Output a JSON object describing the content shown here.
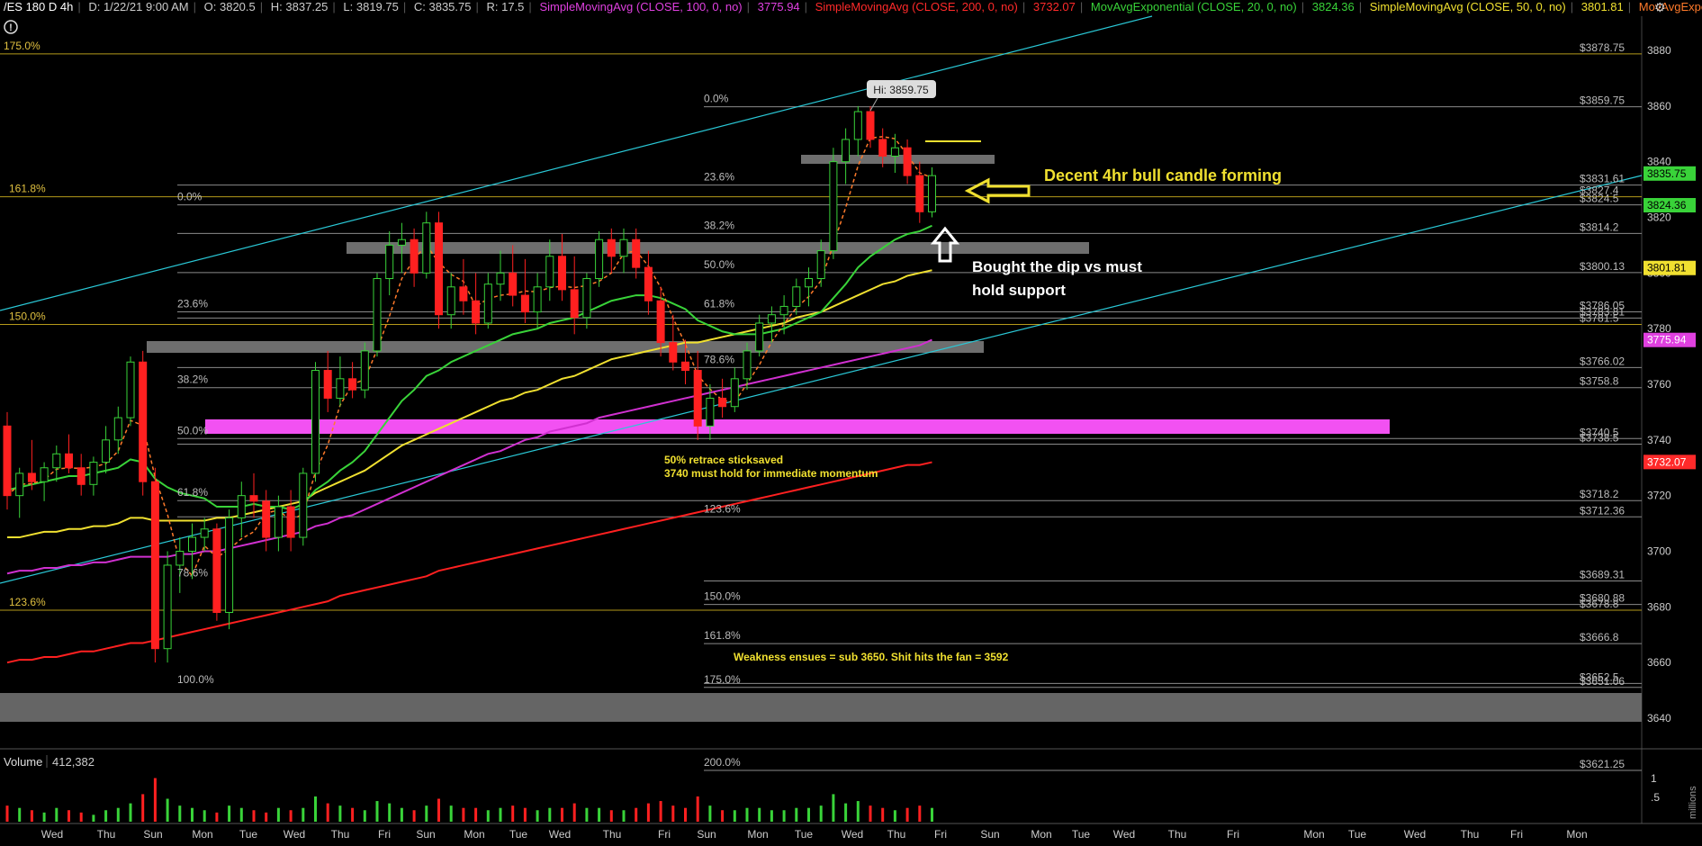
{
  "header": {
    "symbol": "/ES 180 D 4h",
    "date": "D: 1/22/21 9:00 AM",
    "open": "O: 3820.5",
    "high": "H: 3837.25",
    "low": "L: 3819.75",
    "close": "C: 3835.75",
    "range": "R: 17.5",
    "studies": [
      {
        "label": "SimpleMovingAvg (CLOSE, 100, 0, no)",
        "value": "3775.94",
        "color": "#e040e0"
      },
      {
        "label": "SimpleMovingAvg (CLOSE, 200, 0, no)",
        "value": "3732.07",
        "color": "#ff2a2a"
      },
      {
        "label": "MovAvgExponential (CLOSE, 20, 0, no)",
        "value": "3824.36",
        "color": "#39d339"
      },
      {
        "label": "SimpleMovingAvg (CLOSE, 50, 0, no)",
        "value": "3801.81",
        "color": "#f0e030"
      },
      {
        "label": "MovAvgExponential ...",
        "value": "",
        "color": "#ff7a2a"
      }
    ]
  },
  "info_icon": "info-icon",
  "chart_data": {
    "type": "candlestick",
    "symbol": "/ES",
    "timeframe": "4h",
    "ylim": [
      3630,
      3890
    ],
    "yticks": [
      3640,
      3660,
      3680,
      3700,
      3720,
      3740,
      3760,
      3780,
      3800,
      3820,
      3840,
      3860,
      3880
    ],
    "xticks": [
      "Wed",
      "Thu",
      "Sun",
      "Mon",
      "Tue",
      "Wed",
      "Thu",
      "Fri",
      "Sun",
      "Mon",
      "Tue",
      "Wed",
      "Thu",
      "Fri",
      "Sun",
      "Mon",
      "Tue",
      "Wed",
      "Thu",
      "Fri",
      "Sun",
      "Mon",
      "Tue",
      "Wed",
      "Thu",
      "Fri",
      "Mon",
      "Tue",
      "Wed",
      "Thu",
      "Fri",
      "Mon"
    ],
    "hi_label": "Hi: 3859.75",
    "price_levels": [
      "$3878.75",
      "$3859.75",
      "$3831.61",
      "$3827.4",
      "$3824.5",
      "$3814.2",
      "$3800.13",
      "$3786.05",
      "$3783.81",
      "$3781.5",
      "$3766.02",
      "$3758.8",
      "$3740.5",
      "$3738.5",
      "$3718.2",
      "$3712.36",
      "$3689.31",
      "$3680.88",
      "$3678.8",
      "$3666.8",
      "$3652.5",
      "$3651.06",
      "$3621.25"
    ],
    "fib_labels": [
      "175.0%",
      "0.0%",
      "23.6%",
      "161.8%",
      "0.0%",
      "38.2%",
      "50.0%",
      "150.0%",
      "23.6%",
      "61.8%",
      "78.6%",
      "38.2%",
      "50.0%",
      "61.8%",
      "123.6%",
      "78.6%",
      "123.6%",
      "100.0%",
      "150.0%",
      "161.8%",
      "175.0%",
      "200.0%"
    ],
    "axis_badges": [
      {
        "value": "3835.75",
        "price": 3835.75,
        "bg": "#39d339",
        "fg": "#000"
      },
      {
        "value": "3824.36",
        "price": 3824.36,
        "bg": "#39d339",
        "fg": "#000"
      },
      {
        "value": "3801.81",
        "price": 3801.81,
        "bg": "#f0e030",
        "fg": "#000"
      },
      {
        "value": "3775.94",
        "price": 3775.94,
        "bg": "#e040e0",
        "fg": "#fff"
      },
      {
        "value": "3732.07",
        "price": 3732.07,
        "bg": "#ff2a2a",
        "fg": "#fff"
      }
    ],
    "annotations": [
      "Decent 4hr bull candle forming",
      "Bought the dip vs must",
      "hold support",
      "50%  retrace sticksaved",
      "3740 must hold for immediate momentum",
      "Weakness ensues = sub 3650. Shit hits the fan = 3592"
    ],
    "candles": [
      [
        3745,
        3750,
        3715,
        3720
      ],
      [
        3720,
        3730,
        3712,
        3728
      ],
      [
        3728,
        3740,
        3722,
        3725
      ],
      [
        3725,
        3732,
        3718,
        3730
      ],
      [
        3730,
        3738,
        3725,
        3735
      ],
      [
        3735,
        3742,
        3728,
        3730
      ],
      [
        3730,
        3735,
        3720,
        3724
      ],
      [
        3724,
        3734,
        3720,
        3732
      ],
      [
        3732,
        3745,
        3728,
        3740
      ],
      [
        3740,
        3752,
        3735,
        3748
      ],
      [
        3748,
        3770,
        3745,
        3768
      ],
      [
        3768,
        3772,
        3720,
        3725
      ],
      [
        3725,
        3730,
        3660,
        3665
      ],
      [
        3665,
        3700,
        3660,
        3695
      ],
      [
        3695,
        3705,
        3685,
        3700
      ],
      [
        3700,
        3710,
        3690,
        3705
      ],
      [
        3705,
        3712,
        3700,
        3708
      ],
      [
        3708,
        3710,
        3675,
        3678
      ],
      [
        3678,
        3715,
        3672,
        3712
      ],
      [
        3712,
        3725,
        3705,
        3720
      ],
      [
        3720,
        3728,
        3712,
        3718
      ],
      [
        3718,
        3722,
        3700,
        3705
      ],
      [
        3705,
        3720,
        3700,
        3716
      ],
      [
        3716,
        3722,
        3700,
        3705
      ],
      [
        3705,
        3730,
        3702,
        3728
      ],
      [
        3728,
        3768,
        3725,
        3765
      ],
      [
        3765,
        3772,
        3750,
        3755
      ],
      [
        3755,
        3770,
        3752,
        3762
      ],
      [
        3762,
        3768,
        3755,
        3758
      ],
      [
        3758,
        3775,
        3755,
        3772
      ],
      [
        3772,
        3800,
        3770,
        3798
      ],
      [
        3798,
        3815,
        3792,
        3810
      ],
      [
        3810,
        3818,
        3800,
        3812
      ],
      [
        3812,
        3816,
        3795,
        3800
      ],
      [
        3800,
        3822,
        3798,
        3818
      ],
      [
        3818,
        3822,
        3780,
        3785
      ],
      [
        3785,
        3800,
        3780,
        3795
      ],
      [
        3795,
        3805,
        3785,
        3790
      ],
      [
        3790,
        3800,
        3778,
        3782
      ],
      [
        3782,
        3800,
        3780,
        3796
      ],
      [
        3796,
        3808,
        3790,
        3800
      ],
      [
        3800,
        3810,
        3788,
        3792
      ],
      [
        3792,
        3805,
        3782,
        3786
      ],
      [
        3786,
        3800,
        3780,
        3795
      ],
      [
        3795,
        3812,
        3790,
        3806
      ],
      [
        3806,
        3814,
        3790,
        3794
      ],
      [
        3794,
        3806,
        3778,
        3784
      ],
      [
        3784,
        3800,
        3780,
        3798
      ],
      [
        3798,
        3815,
        3795,
        3812
      ],
      [
        3812,
        3816,
        3800,
        3806
      ],
      [
        3806,
        3816,
        3800,
        3812
      ],
      [
        3812,
        3816,
        3798,
        3802
      ],
      [
        3802,
        3808,
        3785,
        3790
      ],
      [
        3790,
        3795,
        3770,
        3775
      ],
      [
        3775,
        3785,
        3765,
        3768
      ],
      [
        3768,
        3776,
        3760,
        3765
      ],
      [
        3765,
        3772,
        3740,
        3745
      ],
      [
        3745,
        3760,
        3740,
        3755
      ],
      [
        3755,
        3762,
        3748,
        3752
      ],
      [
        3752,
        3766,
        3750,
        3762
      ],
      [
        3762,
        3775,
        3758,
        3772
      ],
      [
        3772,
        3785,
        3770,
        3782
      ],
      [
        3782,
        3788,
        3775,
        3785
      ],
      [
        3785,
        3792,
        3778,
        3788
      ],
      [
        3788,
        3798,
        3785,
        3795
      ],
      [
        3795,
        3802,
        3788,
        3798
      ],
      [
        3798,
        3812,
        3795,
        3808
      ],
      [
        3808,
        3845,
        3805,
        3840
      ],
      [
        3840,
        3852,
        3832,
        3848
      ],
      [
        3848,
        3860,
        3842,
        3858
      ],
      [
        3858,
        3860,
        3845,
        3848
      ],
      [
        3848,
        3852,
        3838,
        3842
      ],
      [
        3842,
        3850,
        3836,
        3845
      ],
      [
        3845,
        3848,
        3832,
        3835
      ],
      [
        3835,
        3840,
        3818,
        3822
      ],
      [
        3822,
        3838,
        3820,
        3835
      ]
    ],
    "ema20": [
      3722,
      3723,
      3724,
      3725,
      3726,
      3727,
      3727,
      3728,
      3729,
      3730,
      3733,
      3732,
      3726,
      3723,
      3721,
      3720,
      3719,
      3716,
      3716,
      3716,
      3717,
      3716,
      3716,
      3715,
      3717,
      3722,
      3725,
      3729,
      3732,
      3736,
      3742,
      3748,
      3754,
      3758,
      3763,
      3765,
      3768,
      3770,
      3772,
      3774,
      3776,
      3778,
      3779,
      3780,
      3782,
      3783,
      3784,
      3786,
      3788,
      3790,
      3791,
      3792,
      3792,
      3791,
      3789,
      3787,
      3783,
      3781,
      3779,
      3778,
      3778,
      3778,
      3779,
      3780,
      3782,
      3784,
      3786,
      3791,
      3796,
      3802,
      3806,
      3809,
      3812,
      3814,
      3815,
      3817
    ],
    "sma50": [
      3705,
      3705,
      3706,
      3707,
      3707,
      3708,
      3708,
      3709,
      3709,
      3710,
      3712,
      3712,
      3711,
      3711,
      3711,
      3711,
      3711,
      3712,
      3712,
      3713,
      3714,
      3715,
      3716,
      3717,
      3718,
      3721,
      3723,
      3725,
      3727,
      3729,
      3732,
      3735,
      3738,
      3740,
      3742,
      3744,
      3746,
      3748,
      3750,
      3752,
      3754,
      3755,
      3757,
      3758,
      3760,
      3762,
      3763,
      3765,
      3767,
      3769,
      3770,
      3771,
      3772,
      3773,
      3774,
      3775,
      3775,
      3776,
      3777,
      3778,
      3779,
      3780,
      3781,
      3782,
      3784,
      3785,
      3786,
      3788,
      3790,
      3792,
      3794,
      3796,
      3797,
      3799,
      3800,
      3801
    ],
    "sma100": [
      3692,
      3693,
      3693,
      3694,
      3694,
      3695,
      3695,
      3696,
      3696,
      3697,
      3698,
      3698,
      3698,
      3698,
      3699,
      3699,
      3700,
      3700,
      3701,
      3702,
      3703,
      3704,
      3705,
      3706,
      3707,
      3709,
      3710,
      3712,
      3713,
      3715,
      3717,
      3719,
      3721,
      3723,
      3725,
      3727,
      3729,
      3731,
      3733,
      3735,
      3736,
      3738,
      3740,
      3741,
      3743,
      3744,
      3745,
      3746,
      3748,
      3749,
      3750,
      3751,
      3752,
      3753,
      3754,
      3755,
      3756,
      3757,
      3758,
      3759,
      3760,
      3761,
      3762,
      3763,
      3764,
      3765,
      3766,
      3767,
      3768,
      3769,
      3770,
      3771,
      3772,
      3773,
      3774,
      3776
    ],
    "sma200": [
      3660,
      3661,
      3661,
      3662,
      3662,
      3663,
      3664,
      3664,
      3665,
      3666,
      3667,
      3667,
      3668,
      3669,
      3670,
      3671,
      3672,
      3673,
      3674,
      3675,
      3676,
      3677,
      3678,
      3679,
      3680,
      3681,
      3682,
      3684,
      3685,
      3686,
      3687,
      3688,
      3689,
      3690,
      3691,
      3693,
      3694,
      3695,
      3696,
      3697,
      3698,
      3699,
      3700,
      3701,
      3702,
      3703,
      3704,
      3705,
      3706,
      3707,
      3708,
      3709,
      3710,
      3711,
      3712,
      3713,
      3714,
      3715,
      3716,
      3717,
      3718,
      3719,
      3720,
      3721,
      3722,
      3723,
      3724,
      3725,
      3726,
      3727,
      3728,
      3729,
      3730,
      3731,
      3731,
      3732
    ],
    "volume_label": "Volume",
    "volume_value": "412,382",
    "volume_axis": [
      "1",
      ".5"
    ],
    "volume_unit": "millions",
    "volume": [
      0.35,
      0.3,
      0.25,
      0.2,
      0.3,
      0.25,
      0.2,
      0.15,
      0.25,
      0.3,
      0.4,
      0.6,
      0.95,
      0.5,
      0.35,
      0.3,
      0.25,
      0.2,
      0.35,
      0.3,
      0.25,
      0.2,
      0.3,
      0.25,
      0.3,
      0.55,
      0.4,
      0.35,
      0.3,
      0.25,
      0.45,
      0.4,
      0.3,
      0.25,
      0.35,
      0.5,
      0.35,
      0.3,
      0.3,
      0.25,
      0.3,
      0.35,
      0.3,
      0.25,
      0.3,
      0.3,
      0.4,
      0.3,
      0.3,
      0.25,
      0.25,
      0.3,
      0.4,
      0.45,
      0.35,
      0.3,
      0.55,
      0.35,
      0.25,
      0.25,
      0.3,
      0.3,
      0.25,
      0.25,
      0.3,
      0.3,
      0.35,
      0.6,
      0.4,
      0.45,
      0.35,
      0.3,
      0.25,
      0.3,
      0.35,
      0.3
    ]
  }
}
